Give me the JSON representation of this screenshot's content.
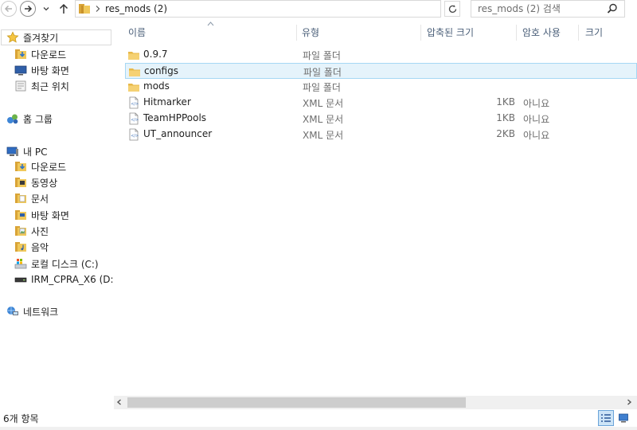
{
  "address": {
    "path": "res_mods (2)",
    "search_placeholder": "res_mods (2) 검색"
  },
  "nav": {
    "favorites": {
      "label": "즐겨찾기",
      "items": [
        "다운로드",
        "바탕 화면",
        "최근 위치"
      ]
    },
    "homegroup": {
      "label": "홈 그룹"
    },
    "pc": {
      "label": "내 PC",
      "items": [
        "다운로드",
        "동영상",
        "문서",
        "바탕 화면",
        "사진",
        "음악",
        "로컬 디스크 (C:)",
        "IRM_CPRA_X6 (D:)"
      ]
    },
    "network": {
      "label": "네트워크"
    }
  },
  "columns": {
    "name": "이름",
    "type": "유형",
    "compressed": "압축된 크기",
    "password": "암호 사용",
    "size": "크기"
  },
  "files": [
    {
      "name": "0.9.7",
      "type": "파일 폴더",
      "size": "",
      "password": "",
      "icon": "folder-icon"
    },
    {
      "name": "configs",
      "type": "파일 폴더",
      "size": "",
      "password": "",
      "icon": "folder-icon"
    },
    {
      "name": "mods",
      "type": "파일 폴더",
      "size": "",
      "password": "",
      "icon": "folder-icon"
    },
    {
      "name": "Hitmarker",
      "type": "XML 문서",
      "size": "1KB",
      "password": "아니요",
      "icon": "xml-file-icon"
    },
    {
      "name": "TeamHPPools",
      "type": "XML 문서",
      "size": "1KB",
      "password": "아니요",
      "icon": "xml-file-icon"
    },
    {
      "name": "UT_announcer",
      "type": "XML 문서",
      "size": "2KB",
      "password": "아니요",
      "icon": "xml-file-icon"
    }
  ],
  "status": {
    "item_count": "6개 항목"
  },
  "colors": {
    "selection_bg": "#e5f3fb",
    "selection_border": "#a6d8f4",
    "header_text": "#4c607a",
    "folder_yellow": "#e8b94a"
  }
}
